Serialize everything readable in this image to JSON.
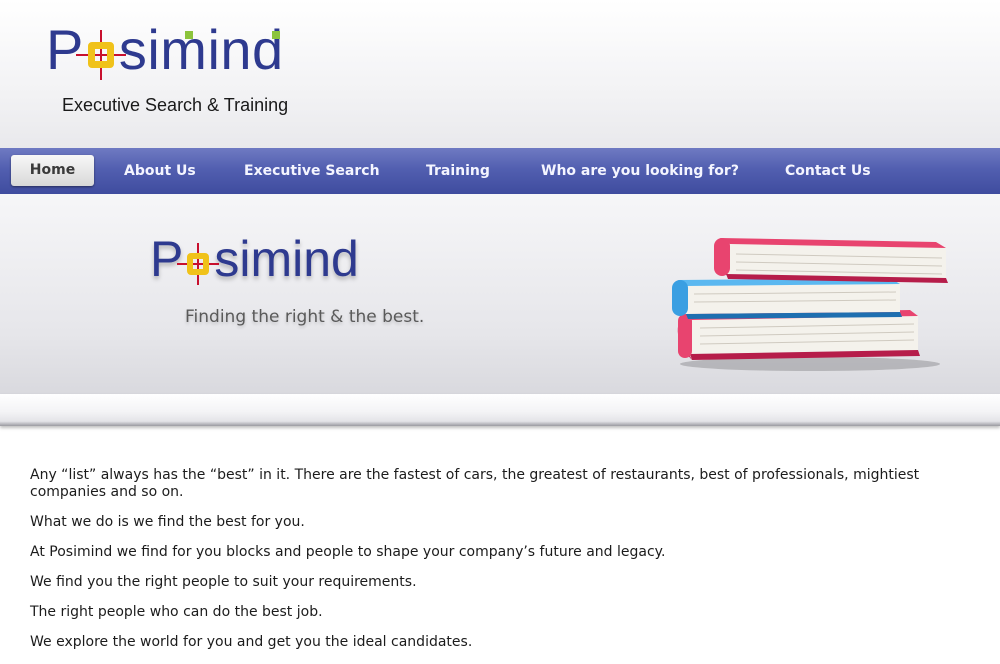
{
  "header": {
    "logo_text_p": "P",
    "logo_text_rest": "simind",
    "tagline": "Executive Search & Training",
    "colors": {
      "logo_blue": "#2e3a8f",
      "logo_yellow": "#f0c21a",
      "logo_green": "#8cc43c",
      "logo_red": "#c8102e"
    }
  },
  "nav": {
    "items": [
      {
        "label": "Home",
        "active": true
      },
      {
        "label": "About Us"
      },
      {
        "label": "Executive Search"
      },
      {
        "label": "Training"
      },
      {
        "label": "Who are you looking for?"
      },
      {
        "label": "Contact Us"
      }
    ],
    "colors": {
      "bar": "#525fb0",
      "text": "#f4f5ff"
    }
  },
  "banner": {
    "logo_text_p": "P",
    "logo_text_rest": "simind",
    "tagline": "Finding the right & the best.",
    "image_icon": "books-stack-icon"
  },
  "content": {
    "paragraphs": [
      "Any “list” always has the “best” in it. There are the fastest of cars, the greatest of restaurants, best of professionals, mightiest companies and so on.",
      "What we do is we find the best for you.",
      "At Posimind we find for you blocks and people to shape your company’s future and legacy.",
      "We find you the right people to suit your requirements.",
      "The right people who can do the best job.",
      "We explore the world for you and get you the ideal candidates."
    ]
  }
}
